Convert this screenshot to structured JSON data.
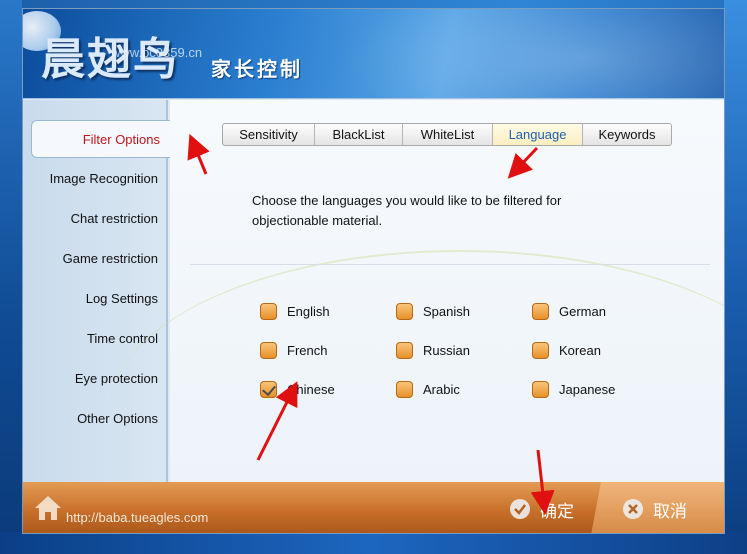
{
  "header": {
    "logo_text": "晨翅鸟",
    "watermark_site": "www.pc0359.cn",
    "subtitle": "家长控制"
  },
  "sidebar": {
    "items": [
      {
        "label": "Filter Options",
        "active": true
      },
      {
        "label": "Image Recognition",
        "active": false
      },
      {
        "label": "Chat restriction",
        "active": false
      },
      {
        "label": "Game restriction",
        "active": false
      },
      {
        "label": "Log Settings",
        "active": false
      },
      {
        "label": "Time control",
        "active": false
      },
      {
        "label": "Eye protection",
        "active": false
      },
      {
        "label": "Other Options",
        "active": false
      }
    ]
  },
  "tabs": [
    {
      "label": "Sensitivity",
      "active": false
    },
    {
      "label": "BlackList",
      "active": false
    },
    {
      "label": "WhiteList",
      "active": false
    },
    {
      "label": "Language",
      "active": true
    },
    {
      "label": "Keywords",
      "active": false
    }
  ],
  "description": "Choose the languages you would like to be filtered for objectionable material.",
  "languages": [
    {
      "label": "English",
      "checked": false
    },
    {
      "label": "Spanish",
      "checked": false
    },
    {
      "label": "German",
      "checked": false
    },
    {
      "label": "French",
      "checked": false
    },
    {
      "label": "Russian",
      "checked": false
    },
    {
      "label": "Korean",
      "checked": false
    },
    {
      "label": "Chinese",
      "checked": true
    },
    {
      "label": "Arabic",
      "checked": false
    },
    {
      "label": "Japanese",
      "checked": false
    }
  ],
  "footer": {
    "url": "http://baba.tueagles.com",
    "ok_label": "确定",
    "cancel_label": "取消"
  },
  "colors": {
    "active_sidebar_text": "#c0161b",
    "active_tab_text": "#1d5fb4",
    "checkbox_fill": "#e8902a",
    "footer_bg": "#c8702a"
  }
}
